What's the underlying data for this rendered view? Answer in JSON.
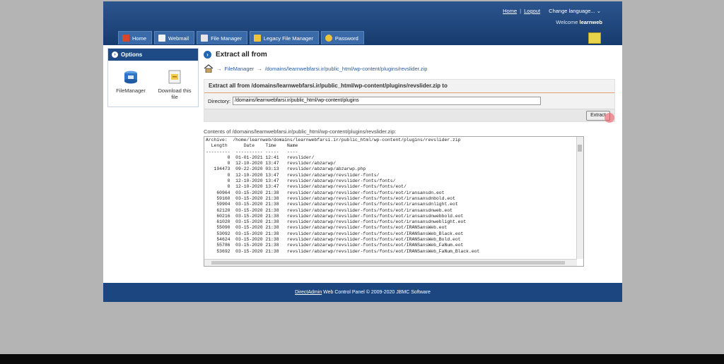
{
  "top": {
    "home": "Home",
    "sep": "|",
    "logout": "Logout",
    "language": "Change language... ⌄",
    "welcome_prefix": "Welcome",
    "username": "learnweb"
  },
  "nav": [
    {
      "label": "Home",
      "icon": "home-icon"
    },
    {
      "label": "Webmail",
      "icon": "mail-icon"
    },
    {
      "label": "File Manager",
      "icon": "folder-icon"
    },
    {
      "label": "Legacy File Manager",
      "icon": "folder-icon"
    },
    {
      "label": "Password",
      "icon": "key-icon"
    }
  ],
  "options": {
    "title": "Options",
    "items": [
      "FileManager",
      "Download this file"
    ]
  },
  "main": {
    "title": "Extract all from",
    "breadcrumb_link": "FileManager",
    "breadcrumb_arrow": "→",
    "breadcrumb_path": "/domains/learnwebfarsi.ir/public_html/wp-content/plugins/revslider.zip",
    "box_title": "Extract all from /domains/learnwebfarsi.ir/public_html/wp-content/plugins/revslider.zip to",
    "directory_label": "Directory:",
    "directory_value": "/domains/learnwebfarsi.ir/public_html/wp-content/plugins",
    "extract_button": "Extract",
    "contents_label": "Contents of /domains/learnwebfarsi.ir/public_html/wp-content/plugins/revslider.zip:",
    "listing": "Archive:  /home/learnweb/domains/learnwebfarsi.ir/public_html/wp-content/plugins/revslider.zip\n  Length      Date    Time    Name\n---------  ---------- -----   ----\n        0  01-01-2021 12:41   revslider/\n        0  12-10-2020 13:47   revslider/abzarwp/\n   194473  09-22-2020 03:13   revslider/abzarwp/abzarwp.php\n        0  12-10-2020 13:47   revslider/abzarwp/revslider-fonts/\n        0  12-10-2020 13:47   revslider/abzarwp/revslider-fonts/fonts/\n        0  12-10-2020 13:47   revslider/abzarwp/revslider-fonts/fonts/eot/\n    60964  03-15-2020 21:38   revslider/abzarwp/revslider-fonts/fonts/eot/iransansdn.eot\n    59160  03-15-2020 21:38   revslider/abzarwp/revslider-fonts/fonts/eot/iransansdnbold.eot\n    59904  03-15-2020 21:38   revslider/abzarwp/revslider-fonts/fonts/eot/iransansdnlight.eot\n    62120  03-15-2020 21:38   revslider/abzarwp/revslider-fonts/fonts/eot/iransansdnweb.eot\n    60216  03-15-2020 21:38   revslider/abzarwp/revslider-fonts/fonts/eot/iransansdnwebbold.eot\n    61020  03-15-2020 21:38   revslider/abzarwp/revslider-fonts/fonts/eot/iransansdnweblight.eot\n    55090  03-15-2020 21:38   revslider/abzarwp/revslider-fonts/fonts/eot/IRANSansWeb.eot\n    53092  03-15-2020 21:38   revslider/abzarwp/revslider-fonts/fonts/eot/IRANSansWeb_Black.eot\n    54624  03-15-2020 21:38   revslider/abzarwp/revslider-fonts/fonts/eot/IRANSansWeb_Bold.eot\n    55786  03-15-2020 21:38   revslider/abzarwp/revslider-fonts/fonts/eot/IRANSansWeb_FaNum.eot\n    53692  03-15-2020 21:38   revslider/abzarwp/revslider-fonts/fonts/eot/IRANSansWeb_FaNum_Black.eot"
  },
  "footer": {
    "link": "DirectAdmin",
    "text": " Web Control Panel © 2009-2020 JBMC Software"
  },
  "colors": {
    "header": "#1e4a86",
    "tab": "#3a6aa8",
    "accent_line": "#e0a070"
  }
}
